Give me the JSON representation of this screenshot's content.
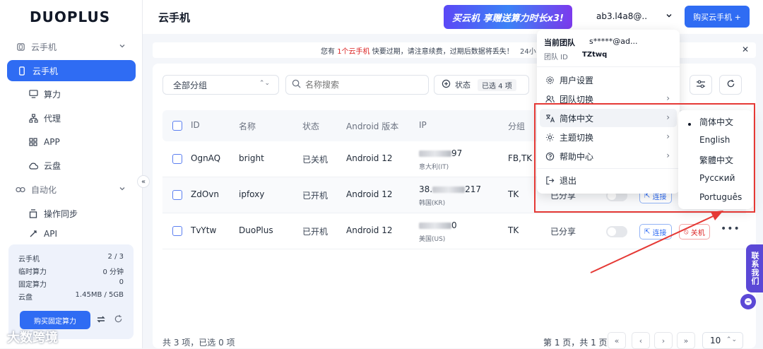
{
  "brand": {
    "logo": "DUOPLUS"
  },
  "sidebar": {
    "groups": [
      {
        "label": "云手机",
        "icon": "cloud-phone-icon"
      },
      {
        "label": "自动化",
        "icon": "automation-icon"
      }
    ],
    "items": [
      {
        "label": "云手机",
        "icon": "phone-icon",
        "active": true
      },
      {
        "label": "算力",
        "icon": "monitor-icon"
      },
      {
        "label": "代理",
        "icon": "proxy-icon"
      },
      {
        "label": "APP",
        "icon": "app-grid-icon"
      },
      {
        "label": "云盘",
        "icon": "cloud-icon"
      },
      {
        "label": "操作同步",
        "icon": "sync-icon"
      },
      {
        "label": "API",
        "icon": "api-icon"
      }
    ],
    "stats": [
      {
        "label": "云手机",
        "value": "2 / 3"
      },
      {
        "label": "临时算力",
        "value": "0 分钟"
      },
      {
        "label": "固定算力",
        "value": "0"
      },
      {
        "label": "云盘",
        "value": "1.45MB / 5GB"
      }
    ],
    "buy_fixed": "购买固定算力"
  },
  "header": {
    "title": "云手机",
    "promo": "买云机 享赠送算力时长x3!",
    "account": "ab3.l4a8@..",
    "buy_cloud": "购买云手机 +"
  },
  "notice": {
    "prefix": "您有",
    "highlight": "1个云手机",
    "suffix": "快要过期，请注意续费，过期后数据将丢失！",
    "more": "24小"
  },
  "filters": {
    "group": "全部分组",
    "search_placeholder": "名称搜索",
    "status_label": "状态",
    "status_tag": "已选 4 项"
  },
  "table": {
    "headers": [
      "ID",
      "名称",
      "状态",
      "Android 版本",
      "IP",
      "分组"
    ],
    "rows": [
      {
        "id": "OgnAQ",
        "name": "bright",
        "status": "已关机",
        "android": "Android 12",
        "ip_pre": "",
        "ip_suf": "97",
        "region": "意大利(IT)",
        "group": "FB,TK",
        "share": "",
        "has_actions": false
      },
      {
        "id": "ZdOvn",
        "name": "ipfoxy",
        "status": "已开机",
        "android": "Android 12",
        "ip_pre": "38.",
        "ip_suf": "217",
        "region": "韩国(KR)",
        "group": "TK",
        "share": "已分享",
        "link": "连接",
        "has_actions": false
      },
      {
        "id": "TvYtw",
        "name": "DuoPlus",
        "status": "已开机",
        "android": "Android 12",
        "ip_pre": "",
        "ip_suf": "0",
        "region": "美国(US)",
        "group": "TK",
        "share": "已分享",
        "link": "连接",
        "off": "关机",
        "has_actions": true
      }
    ]
  },
  "footer": {
    "summary": "共 3 项，已选 0 项",
    "page_info": "第 1 页，共 1 页",
    "page_size": "10"
  },
  "dropdown": {
    "team_label": "当前团队",
    "email": "s*****@ad...",
    "team_id_label": "团队 ID",
    "team_id": "TZtwq",
    "items": [
      {
        "label": "用户设置",
        "icon": "gear-icon",
        "arrow": false
      },
      {
        "label": "团队切换",
        "icon": "team-icon",
        "arrow": true
      },
      {
        "label": "简体中文",
        "icon": "translate-icon",
        "arrow": true
      },
      {
        "label": "主题切换",
        "icon": "sun-icon",
        "arrow": true
      },
      {
        "label": "帮助中心",
        "icon": "help-icon",
        "arrow": true
      },
      {
        "label": "退出",
        "icon": "logout-icon",
        "arrow": false
      }
    ]
  },
  "languages": [
    "简体中文",
    "English",
    "繁體中文",
    "Русский",
    "Português"
  ],
  "contact": "联系我们",
  "watermark": "大数跨境",
  "colors": {
    "accent": "#2f6cf3",
    "annotation": "#e53935",
    "danger": "#dc2626"
  }
}
